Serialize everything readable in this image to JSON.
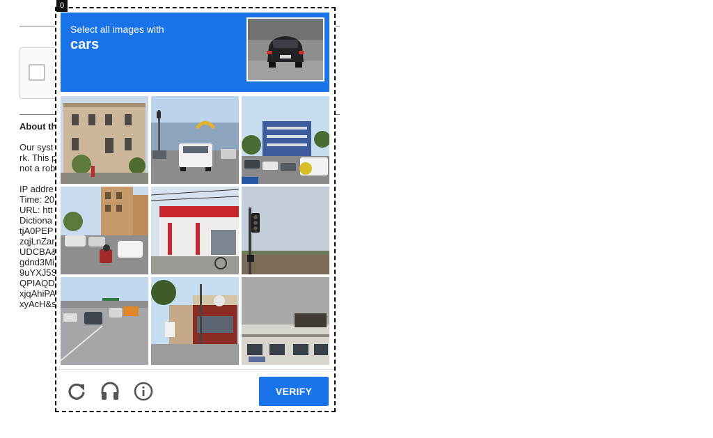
{
  "background_page": {
    "heading": "About th",
    "paragraph_lines": [
      "Our syst",
      "rk. This p",
      "not a rob"
    ],
    "info_lines": [
      "IP addre",
      "Time: 20",
      "URL: htt",
      "Dictiona",
      "tjA0PEP",
      "zqjLnZar",
      "UDCBA&",
      "gdnd3Mi",
      "9uYXJ5S",
      "QPIAQD",
      "xjqAhiPA",
      "xyAcH&s"
    ]
  },
  "challenge": {
    "index_badge": "0",
    "prompt": "Select all images with",
    "keyword": "cars",
    "sample_icon": "car-rear-photo",
    "accent_color": "#1a73e8",
    "tiles": [
      {
        "name": "tile-beige-building",
        "icon": "building-photo"
      },
      {
        "name": "tile-white-pickup-truck",
        "icon": "truck-street-photo"
      },
      {
        "name": "tile-parking-lot-cars",
        "icon": "parking-lot-photo"
      },
      {
        "name": "tile-street-cars-scooters",
        "icon": "street-traffic-photo"
      },
      {
        "name": "tile-red-white-storefront",
        "icon": "storefront-photo"
      },
      {
        "name": "tile-traffic-light",
        "icon": "traffic-light-photo"
      },
      {
        "name": "tile-highway-traffic",
        "icon": "highway-photo"
      },
      {
        "name": "tile-fast-food-restaurant",
        "icon": "restaurant-photo"
      },
      {
        "name": "tile-shop-building",
        "icon": "shop-building-photo"
      }
    ],
    "footer": {
      "reload_icon": "reload-icon",
      "audio_icon": "headphones-icon",
      "info_icon": "info-icon",
      "verify_label": "VERIFY"
    }
  }
}
